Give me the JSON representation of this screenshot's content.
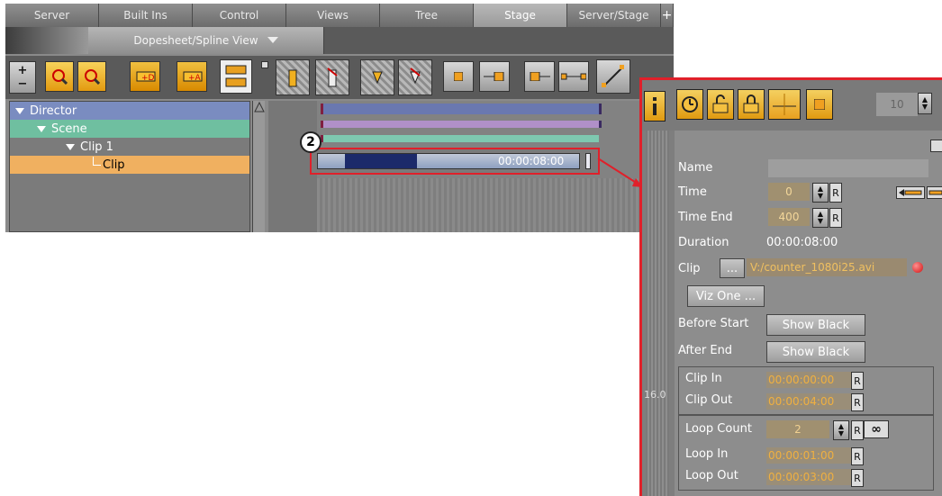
{
  "tabs": [
    "Server",
    "Built Ins",
    "Control",
    "Views",
    "Tree",
    "Stage",
    "Server/Stage",
    "+"
  ],
  "active_tab": "Stage",
  "view_selector": {
    "label": "Dopesheet/Spline View",
    "arrow": "chevron-down-icon"
  },
  "toolbar_icons": [
    "zoom-in-icon",
    "zoom-out-icon",
    "zoom-search-icon",
    "zoom-fit-icon",
    "add-director-icon",
    "add-actor-icon",
    "expand-collapse-icon",
    "keyframe-a-icon",
    "keyframe-b-icon",
    "keyframe-c-icon",
    "keyframe-d-icon",
    "stop-point-icon",
    "tag-in-icon",
    "tag-out-icon",
    "tag-both-icon",
    "spline-icon"
  ],
  "tree": {
    "items": [
      {
        "label": "Director",
        "level": 0
      },
      {
        "label": "Scene",
        "level": 1
      },
      {
        "label": "Clip 1",
        "level": 2
      },
      {
        "label": "Clip",
        "level": 3
      }
    ]
  },
  "timeline": {
    "clip_time": "00:00:08:00",
    "callout_number": "2"
  },
  "colors": {
    "director": "#7a8cc0",
    "scene": "#6fbfa0",
    "clip_selected": "#f0b060",
    "highlight": "#e0202a"
  },
  "panel": {
    "toolbar_icons": [
      "info-icon",
      "clock-icon",
      "lock-open-icon",
      "lock-icon",
      "grid-icon",
      "stop-icon"
    ],
    "spinner_value": "10",
    "side_value": "16.0",
    "name_label": "Name",
    "name_value": "",
    "time_label": "Time",
    "time_value": "0",
    "time_end_label": "Time End",
    "time_end_value": "400",
    "duration_label": "Duration",
    "duration_value": "00:00:08:00",
    "clip_label": "Clip",
    "clip_browse": "...",
    "clip_path": "V:/counter_1080i25.avi",
    "viz_one_button": "Viz One ...",
    "before_start_label": "Before Start",
    "before_start_value": "Show Black",
    "after_end_label": "After End",
    "after_end_value": "Show Black",
    "clip_in_label": "Clip In",
    "clip_in_value": "00:00:00:00",
    "clip_out_label": "Clip Out",
    "clip_out_value": "00:00:04:00",
    "loop_count_label": "Loop Count",
    "loop_count_value": "2",
    "loop_in_label": "Loop In",
    "loop_in_value": "00:00:01:00",
    "loop_out_label": "Loop Out",
    "loop_out_value": "00:00:03:00",
    "reset_label": "R",
    "infinity_label": "∞"
  }
}
